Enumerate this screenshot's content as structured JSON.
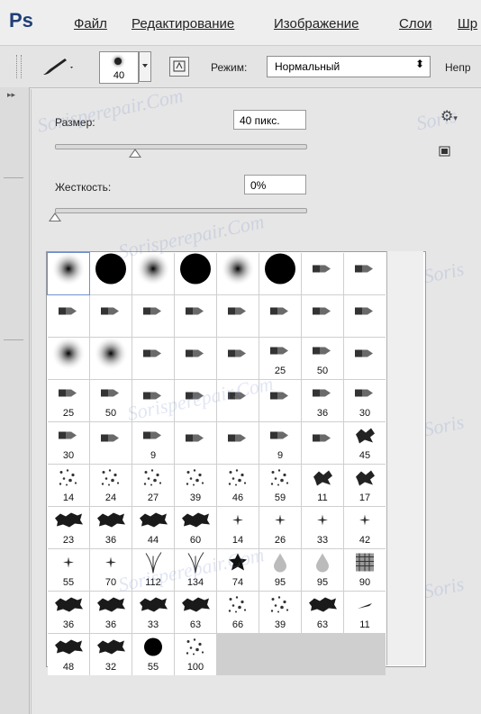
{
  "app": {
    "logo": "Ps"
  },
  "menu": [
    "Файл",
    "Редактирование",
    "Изображение",
    "Слои",
    "Шр"
  ],
  "options": {
    "brush_size_badge": "40",
    "mode_label": "Режим:",
    "mode_value": "Нормальный",
    "opacity_label_cut": "Непр"
  },
  "brush_panel": {
    "size_label": "Размер:",
    "size_value": "40 пикс.",
    "size_level": 0.32,
    "hardness_label": "Жесткость:",
    "hardness_value": "0%",
    "hardness_level": 0.0
  },
  "brushes": [
    {
      "shape": "soft-round",
      "label": ""
    },
    {
      "shape": "hard-round",
      "label": ""
    },
    {
      "shape": "soft-round",
      "label": ""
    },
    {
      "shape": "hard-round",
      "label": ""
    },
    {
      "shape": "soft-round",
      "label": ""
    },
    {
      "shape": "hard-round",
      "label": ""
    },
    {
      "shape": "bristle",
      "label": ""
    },
    {
      "shape": "bristle",
      "label": ""
    },
    {
      "shape": "bristle",
      "label": ""
    },
    {
      "shape": "bristle",
      "label": ""
    },
    {
      "shape": "bristle",
      "label": ""
    },
    {
      "shape": "bristle",
      "label": ""
    },
    {
      "shape": "bristle",
      "label": ""
    },
    {
      "shape": "bristle",
      "label": ""
    },
    {
      "shape": "bristle",
      "label": ""
    },
    {
      "shape": "bristle",
      "label": ""
    },
    {
      "shape": "soft-round",
      "label": ""
    },
    {
      "shape": "soft-round",
      "label": ""
    },
    {
      "shape": "bristle",
      "label": ""
    },
    {
      "shape": "bristle",
      "label": ""
    },
    {
      "shape": "bristle",
      "label": ""
    },
    {
      "shape": "bristle",
      "label": "25"
    },
    {
      "shape": "bristle",
      "label": "50"
    },
    {
      "shape": "bristle",
      "label": ""
    },
    {
      "shape": "bristle",
      "label": "25"
    },
    {
      "shape": "bristle",
      "label": "50"
    },
    {
      "shape": "bristle",
      "label": ""
    },
    {
      "shape": "bristle",
      "label": ""
    },
    {
      "shape": "bristle",
      "label": ""
    },
    {
      "shape": "bristle",
      "label": ""
    },
    {
      "shape": "bristle",
      "label": "36"
    },
    {
      "shape": "bristle",
      "label": "30"
    },
    {
      "shape": "bristle",
      "label": "30"
    },
    {
      "shape": "bristle",
      "label": ""
    },
    {
      "shape": "bristle",
      "label": "9"
    },
    {
      "shape": "bristle",
      "label": ""
    },
    {
      "shape": "bristle",
      "label": ""
    },
    {
      "shape": "bristle",
      "label": "9"
    },
    {
      "shape": "bristle",
      "label": ""
    },
    {
      "shape": "splatter",
      "label": "45"
    },
    {
      "shape": "scatter",
      "label": "14"
    },
    {
      "shape": "scatter",
      "label": "24"
    },
    {
      "shape": "scatter",
      "label": "27"
    },
    {
      "shape": "scatter",
      "label": "39"
    },
    {
      "shape": "scatter",
      "label": "46"
    },
    {
      "shape": "scatter",
      "label": "59"
    },
    {
      "shape": "splatter",
      "label": "11"
    },
    {
      "shape": "splatter",
      "label": "17"
    },
    {
      "shape": "chalk",
      "label": "23"
    },
    {
      "shape": "chalk",
      "label": "36"
    },
    {
      "shape": "chalk",
      "label": "44"
    },
    {
      "shape": "chalk",
      "label": "60"
    },
    {
      "shape": "star",
      "label": "14"
    },
    {
      "shape": "star",
      "label": "26"
    },
    {
      "shape": "star",
      "label": "33"
    },
    {
      "shape": "star",
      "label": "42"
    },
    {
      "shape": "star",
      "label": "55"
    },
    {
      "shape": "star",
      "label": "70"
    },
    {
      "shape": "grass",
      "label": "112"
    },
    {
      "shape": "grass",
      "label": "134"
    },
    {
      "shape": "leaf",
      "label": "74"
    },
    {
      "shape": "drop",
      "label": "95"
    },
    {
      "shape": "drop",
      "label": "95"
    },
    {
      "shape": "texture",
      "label": "90"
    },
    {
      "shape": "chalk",
      "label": "36"
    },
    {
      "shape": "chalk",
      "label": "36"
    },
    {
      "shape": "chalk",
      "label": "33"
    },
    {
      "shape": "chalk",
      "label": "63"
    },
    {
      "shape": "scatter",
      "label": "66"
    },
    {
      "shape": "scatter",
      "label": "39"
    },
    {
      "shape": "chalk",
      "label": "63"
    },
    {
      "shape": "streak",
      "label": "11"
    },
    {
      "shape": "chalk",
      "label": "48"
    },
    {
      "shape": "chalk",
      "label": "32"
    },
    {
      "shape": "hard-round",
      "label": "55"
    },
    {
      "shape": "scatter",
      "label": "100"
    }
  ],
  "watermarks": [
    "Sorisperepair.Com",
    "Sorisperepair.Com",
    "Sorisperepair.Com",
    "Sorisperepair.Com",
    "Soris",
    "Soris",
    "Soris",
    "Soris"
  ]
}
